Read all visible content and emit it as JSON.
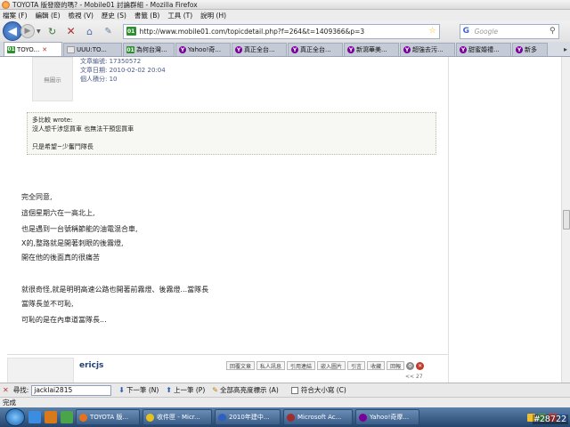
{
  "window": {
    "title": "TOYOTA 版發廢的嗎? - Mobile01 討論群組 - Mozilla Firefox"
  },
  "menu": {
    "items": [
      "檔案 (F)",
      "編輯 (E)",
      "檢視 (V)",
      "歷史 (S)",
      "書籤 (B)",
      "工具 (T)",
      "說明 (H)"
    ]
  },
  "navigation": {
    "url": "http://www.mobile01.com/topicdetail.php?f=264&t=1409366&p=3",
    "search_placeholder": "Google"
  },
  "tabs": [
    {
      "label": "TOYO...",
      "favicon": "mobile01",
      "active": true
    },
    {
      "label": "UUU:TO...",
      "favicon": "doc",
      "active": false
    },
    {
      "label": "為何台灣...",
      "favicon": "mobile01",
      "active": false
    },
    {
      "label": "Yahoo!奇...",
      "favicon": "yahoo",
      "active": false
    },
    {
      "label": "真正全台...",
      "favicon": "yahoo",
      "active": false
    },
    {
      "label": "真正全台...",
      "favicon": "yahoo",
      "active": false
    },
    {
      "label": "新瀉華美...",
      "favicon": "yahoo",
      "active": false
    },
    {
      "label": "超強去污...",
      "favicon": "yahoo",
      "active": false
    },
    {
      "label": "甜蜜婚禮...",
      "favicon": "yahoo",
      "active": false
    },
    {
      "label": "新多",
      "favicon": "yahoo",
      "active": false
    }
  ],
  "post1": {
    "avatar_text": "無圖示",
    "meta_posts": "文章編號: 17350572",
    "meta_date": "文章日期: 2010-02-02 20:04",
    "meta_rating": "個人積分: 10",
    "quote_header": "多比較 wrote:",
    "quote_line1": "沒人想千涉您買車 也無法干預您買車",
    "quote_line2": "只是希望~少奮鬥隊長",
    "body": [
      "完全同意,",
      "這個星期六在一高北上,",
      "也是遇到一台號稱節能的油電混合車,",
      "X的,整路就是開著刺眼的後霧燈,",
      "開在他的後面真的很痛苦",
      "",
      "就很奇怪,就是明明高速公路也開著前霧燈、後霧燈...當隊長",
      "當隊長並不可恥,",
      "可恥的是在內車道當隊長..."
    ]
  },
  "post2": {
    "author": "ericjs",
    "actions": [
      "回覆文章",
      "私人訊息",
      "引用連結",
      "嵌入圖片",
      "引言",
      "收藏",
      "回報"
    ],
    "pager": "<< 27"
  },
  "findbar": {
    "label": "尋找:",
    "query": "jacklai2815",
    "next": "下一筆 (N)",
    "prev": "上一筆 (P)",
    "highlight": "全部高亮度標示 (A)",
    "match_case": "符合大小寫 (C)"
  },
  "status": {
    "text": "完成"
  },
  "taskbar": {
    "items": [
      "TOYOTA 版...",
      "收件匣 - Micr...",
      "2010年建中...",
      "Microsoft Ac...",
      "Yahoo!奇摩..."
    ],
    "watermark": "#28722"
  }
}
